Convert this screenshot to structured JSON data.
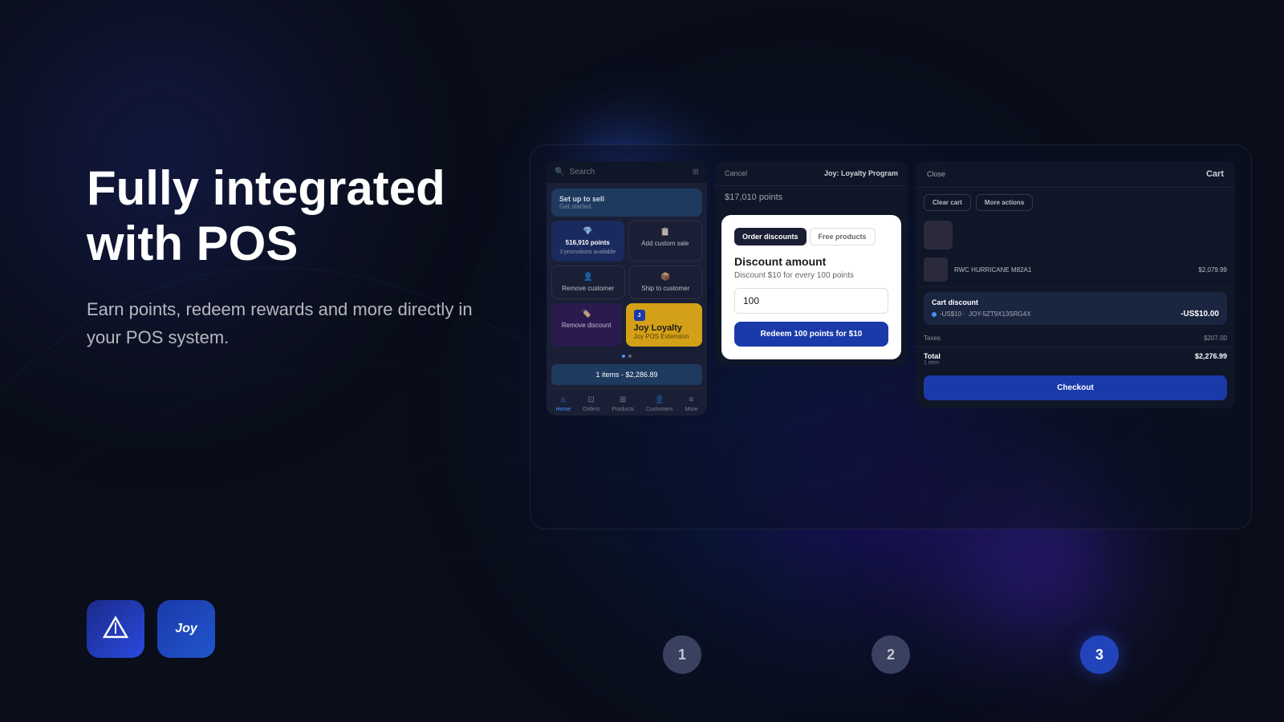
{
  "background": {
    "color": "#0a0e1a"
  },
  "left": {
    "heading_line1": "Fully integrated",
    "heading_line2": "with POS",
    "subtext": "Earn points, redeem rewards and more directly in your POS system."
  },
  "logos": {
    "avada_label": "avada",
    "joy_label": "Joy"
  },
  "panel1": {
    "search_placeholder": "Search",
    "setup_label": "Set up to sell",
    "setup_sub": "Get started",
    "points_value": "516,910 points",
    "promo_label": "3 promotions available",
    "add_custom_label": "Add custom sale",
    "remove_customer": "Remove customer",
    "ship_customer": "Ship to customer",
    "remove_discount": "Remove discount",
    "joy_loyalty_title": "Joy Loyalty",
    "joy_pos_sub": "Joy POS Extension",
    "cart_bar": "1 items - $2,286.89",
    "nav_home": "Home",
    "nav_orders": "Orders",
    "nav_products": "Products",
    "nav_customers": "Customers",
    "nav_more": "More"
  },
  "panel2": {
    "cancel_label": "Cancel",
    "title": "Joy: Loyalty Program",
    "points_display": "$17,010 points",
    "tab_order": "Order discounts",
    "tab_free": "Free products",
    "discount_title": "Discount amount",
    "discount_desc": "Discount $10 for every 100 points",
    "points_input_value": "100",
    "redeem_btn": "Redeem 100 points for $10"
  },
  "panel3": {
    "close_label": "Close",
    "cart_title": "Cart",
    "clear_cart": "Clear cart",
    "more_actions": "More actions",
    "product_name": "RWC HURRICANE M82A1",
    "product_price": "$2,079.99",
    "discount_section_title": "Cart discount",
    "discount_code": "JOY-5ZT9X13SRG4X",
    "discount_value": "-US$10.00",
    "discount_label": "-US$10 ·",
    "taxes_label": "Taxes",
    "taxes_value": "$207.00",
    "total_label": "Total",
    "total_sub": "1 item",
    "total_value": "$2,276.99",
    "checkout_btn": "Checkout"
  },
  "steps": {
    "step1": "1",
    "step2": "2",
    "step3": "3"
  }
}
